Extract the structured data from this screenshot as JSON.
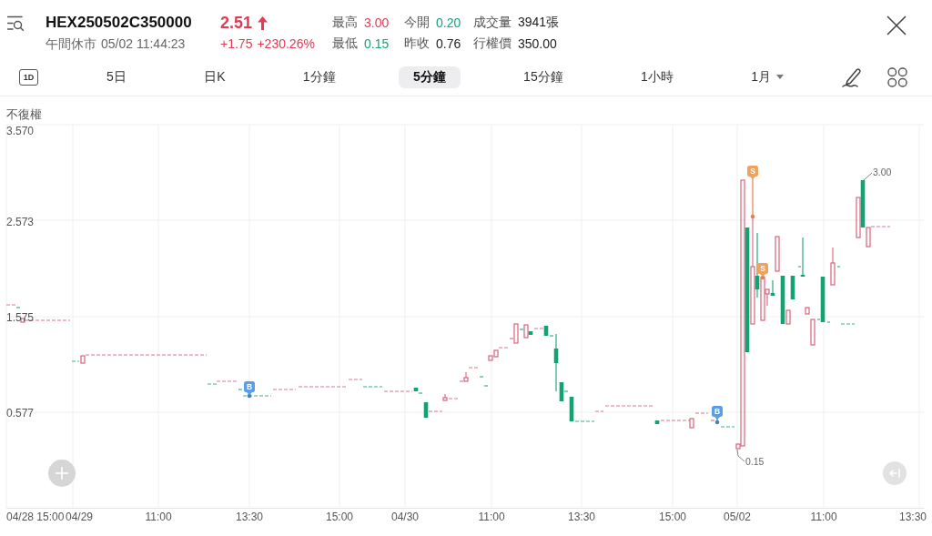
{
  "quote": {
    "symbol": "HEX250502C350000",
    "status": "午間休市",
    "time": "05/02 11:44:23",
    "price": "2.51",
    "change": "+1.75",
    "change_percent": "+230.26%",
    "rising": true
  },
  "stats": [
    {
      "label": "最高",
      "value": "3.00",
      "color": "#e23b55"
    },
    {
      "label": "今開",
      "value": "0.20",
      "color": "#17a079"
    },
    {
      "label": "成交量",
      "value": "3941張",
      "color": "#222222"
    },
    {
      "label": "最低",
      "value": "0.15",
      "color": "#17a079"
    },
    {
      "label": "昨收",
      "value": "0.76",
      "color": "#222222"
    },
    {
      "label": "行權價",
      "value": "350.00",
      "color": "#222222"
    }
  ],
  "toolbar": {
    "range_button": "1D",
    "intervals": [
      {
        "label": "5日",
        "selected": false,
        "dropdown": false
      },
      {
        "label": "日K",
        "selected": false,
        "dropdown": false
      },
      {
        "label": "1分鐘",
        "selected": false,
        "dropdown": false
      },
      {
        "label": "5分鐘",
        "selected": true,
        "dropdown": false
      },
      {
        "label": "15分鐘",
        "selected": false,
        "dropdown": false
      },
      {
        "label": "1小時",
        "selected": false,
        "dropdown": false
      },
      {
        "label": "1月",
        "selected": false,
        "dropdown": true
      }
    ]
  },
  "chart": {
    "adjustment": "不復權",
    "y_labels": [
      "3.570",
      "2.573",
      "1.575",
      "0.577"
    ],
    "x_labels": [
      "04/28 15:00",
      "04/29",
      "11:00",
      "13:30",
      "15:00",
      "04/30",
      "11:00",
      "13:30",
      "15:00",
      "05/02",
      "11:00",
      "13:30"
    ],
    "trade_markers": [
      {
        "label": "B",
        "kind": "buy"
      },
      {
        "label": "B",
        "kind": "buy"
      },
      {
        "label": "S",
        "kind": "sell"
      },
      {
        "label": "S",
        "kind": "sell"
      }
    ],
    "annotations": [
      {
        "label": "3.00",
        "kind": "high"
      },
      {
        "label": "0.15",
        "kind": "low"
      }
    ]
  }
}
